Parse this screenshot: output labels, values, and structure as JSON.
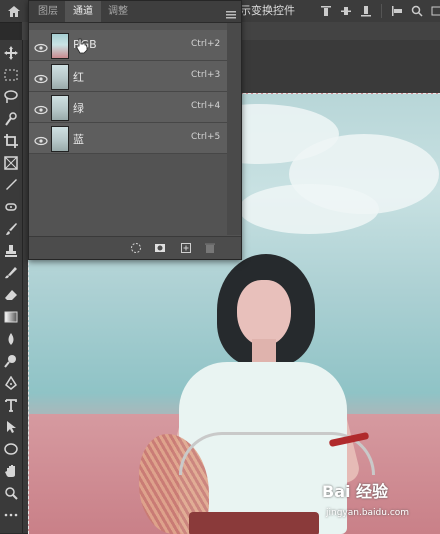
{
  "topbar": {
    "options_text": "示变换控件",
    "align_icons": [
      "align-top-icon",
      "align-vcenter-icon",
      "align-bottom-icon",
      "align-left-icon",
      "search-icon",
      "more-icon"
    ]
  },
  "panel": {
    "tabs": [
      "图层",
      "通道",
      "调整"
    ],
    "active_tab": "通道",
    "channels": [
      {
        "name": "RGB",
        "shortcut": "Ctrl+2"
      },
      {
        "name": "红",
        "shortcut": "Ctrl+3"
      },
      {
        "name": "绿",
        "shortcut": "Ctrl+4"
      },
      {
        "name": "蓝",
        "shortcut": "Ctrl+5"
      }
    ],
    "footer_icons": [
      "load-selection-icon",
      "save-selection-icon",
      "new-channel-icon",
      "delete-channel-icon"
    ]
  },
  "watermark": {
    "brand": "Bai 经验",
    "url": "jingyan.baidu.com"
  },
  "colors": {
    "panel_bg": "#535353",
    "toolbar_bg": "#3a3a3a",
    "accent_red": "#b02a2c"
  }
}
